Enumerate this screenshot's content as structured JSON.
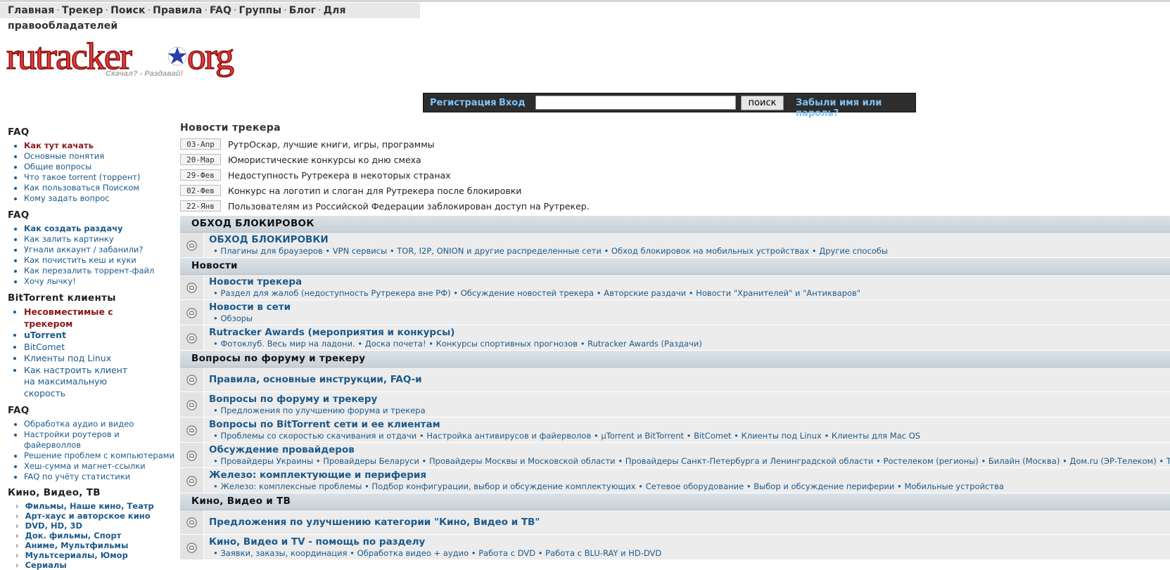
{
  "nav": {
    "items": [
      "Главная",
      "Трекер",
      "Поиск",
      "Правила",
      "FAQ",
      "Группы",
      "Блог",
      "Для правообладателей"
    ],
    "separator": "·"
  },
  "logo": {
    "text_left": "rutracker",
    "text_right": "org",
    "slogan": "Скачал? - Раздавай!"
  },
  "login": {
    "register": "Регистрация",
    "dot": "·",
    "login": "Вход",
    "search_button": "поиск",
    "forgot": "Забыли имя или пароль?"
  },
  "sidebar": {
    "sections": [
      {
        "title": "FAQ",
        "style": "small",
        "items": [
          {
            "label": "Как тут качать",
            "cls": "red"
          },
          {
            "label": "Основные понятия"
          },
          {
            "label": "Общие вопросы"
          },
          {
            "label": "Что такое torrent (торрент)"
          },
          {
            "label": "Как пользоваться Поиском"
          },
          {
            "label": "Кому задать вопрос"
          }
        ]
      },
      {
        "title": "FAQ",
        "style": "small",
        "items": [
          {
            "label": "Как создать раздачу",
            "cls": "bold"
          },
          {
            "label": "Как залить картинку"
          },
          {
            "label": "Угнали аккаунт / забанили?"
          },
          {
            "label": "Как почистить кеш и куки"
          },
          {
            "label": "Как перезалить торрент-файл"
          },
          {
            "label": "Хочу лычку!"
          }
        ]
      },
      {
        "title": "BitTorrent клиенты",
        "style": "big",
        "items": [
          {
            "label": "Несовместимые с трекером",
            "cls": "red"
          },
          {
            "label": "uTorrent",
            "cls": "bold"
          },
          {
            "label": "BitComet"
          },
          {
            "label": "Клиенты под Linux"
          },
          {
            "label": "Как настроить клиент на максимальную скорость"
          }
        ]
      },
      {
        "title": "FAQ",
        "style": "small",
        "items": [
          {
            "label": "Обработка аудио и видео"
          },
          {
            "label": "Настройки роутеров и файерволлов"
          },
          {
            "label": "Решение проблем с компьютерами"
          },
          {
            "label": "Хеш-сумма и магнет-ссылки"
          },
          {
            "label": "FAQ по учёту статистики"
          }
        ]
      },
      {
        "title": "Кино, Видео, ТВ",
        "style": "arrow",
        "items": [
          {
            "label": "Фильмы, Наше кино, Театр"
          },
          {
            "label": "Арт-хаус и авторское кино"
          },
          {
            "label": "DVD, HD, 3D"
          },
          {
            "label": "Док. фильмы, Спорт"
          },
          {
            "label": "Аниме, Мультфильмы"
          },
          {
            "label": "Мультсериалы, Юмор"
          },
          {
            "label": "Сериалы"
          }
        ]
      }
    ]
  },
  "news": {
    "title": "Новости трекера",
    "items": [
      {
        "date": "03-Апр",
        "text": "РутрОскар, лучшие книги, игры, программы"
      },
      {
        "date": "20-Мар",
        "text": "Юмористические конкурсы ко дню смеха"
      },
      {
        "date": "29-Фев",
        "text": "Недоступность Рутрекера в некоторых странах"
      },
      {
        "date": "02-Фев",
        "text": "Конкурс на логотип и слоган для Рутрекера после блокировки"
      },
      {
        "date": "22-Янв",
        "text": "Пользователям из Российской Федерации заблокирован доступ на Рутрекер."
      }
    ]
  },
  "forum": {
    "categories": [
      {
        "name": "ОБХОД БЛОКИРОВОК",
        "forums": [
          {
            "title": "ОБХОД БЛОКИРОВКИ",
            "subs": "• Плагины для браузеров • VPN сервисы • TOR, I2P, ONION и другие распределенные сети • Обход блокировок на мобильных устройствах • Другие способы"
          }
        ]
      },
      {
        "name": "Новости",
        "forums": [
          {
            "title": "Новости трекера",
            "subs": "• Раздел для жалоб (недоступность Рутрекера вне РФ) • Обсуждение новостей трекера • Авторские раздачи • Новости \"Хранителей\" и \"Антикваров\""
          },
          {
            "title": "Новости в сети",
            "subs": "• Обзоры"
          },
          {
            "title": "Rutracker Awards (мероприятия и конкурсы)",
            "subs": "• Фотоклуб. Весь мир на ладони. • Доска почета! • Конкурсы спортивных прогнозов • Rutracker Awards (Раздачи)"
          }
        ]
      },
      {
        "name": "Вопросы по форуму и трекеру",
        "forums": [
          {
            "title": "Правила, основные инструкции, FAQ-и",
            "subs": ""
          },
          {
            "title": "Вопросы по форуму и трекеру",
            "subs": "• Предложения по улучшению форума и трекера"
          },
          {
            "title": "Вопросы по BitTorrent сети и ее клиентам",
            "subs": "• Проблемы со скоростью скачивания и отдачи • Настройка антивирусов и файерволов • µTorrent и BitTorrent • BitComet • Клиенты под Linux • Клиенты для Mac OS"
          },
          {
            "title": "Обсуждение провайдеров",
            "subs": "• Провайдеры Украины • Провайдеры Беларуси • Провайдеры Москвы и Московской области • Провайдеры Санкт-Петербурга и Ленинградской области • Ростелеком (регионы) • Билайн (Москва) • Дом.ru (ЭР-Телеком) • ТТК (Тр"
          },
          {
            "title": "Железо: комплектующие и периферия",
            "subs": "• Железо: комплексные проблемы • Подбор конфигурации, выбор и обсуждение комплектующих • Сетевое оборудование • Выбор и обсуждение периферии • Мобильные устройства"
          }
        ]
      },
      {
        "name": "Кино, Видео и ТВ",
        "forums": [
          {
            "title": "Предложения по улучшению категории \"Кино, Видео и ТВ\"",
            "subs": ""
          },
          {
            "title": "Кино, Видео и TV - помощь по разделу",
            "subs": "• Заявки, заказы, координация • Обработка видео + аудио • Работа с DVD • Работа с BLU-RAY и HD-DVD"
          }
        ]
      }
    ]
  }
}
